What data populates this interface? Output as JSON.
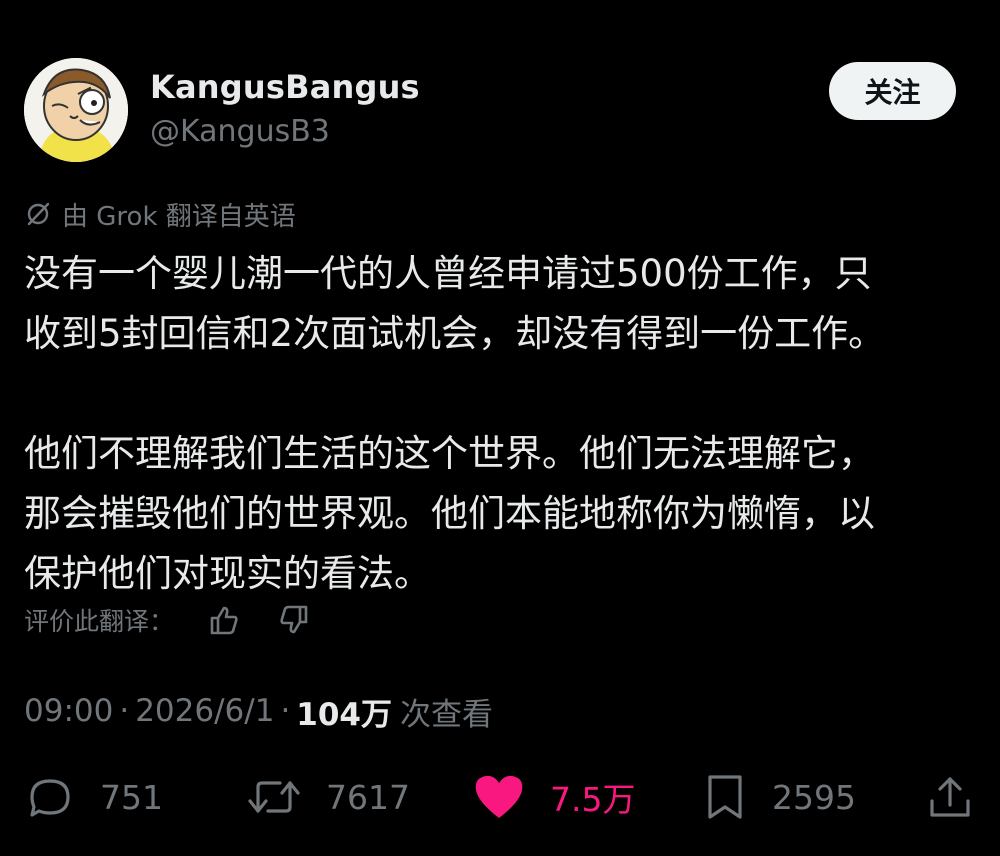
{
  "user": {
    "display_name": "KangusBangus",
    "handle": "@KangusB3",
    "avatar_icon": "cartoon-avatar"
  },
  "follow_label": "关注",
  "translation_note": "由 Grok 翻译自英语",
  "tweet_text": "没有一个婴儿潮一代的人曾经申请过500份工作，只\n收到5封回信和2次面试机会，却没有得到一份工作。\n\n他们不理解我们生活的这个世界。他们无法理解它，\n那会摧毁他们的世界观。他们本能地称你为懒惰，以\n保护他们对现实的看法。",
  "rate_translation_label": "评价此翻译：",
  "meta": {
    "time": "09:00",
    "separator": "·",
    "date": "2026/6/1",
    "views_count": "104万",
    "views_label": "次查看"
  },
  "actions": {
    "reply_count": "751",
    "retweet_count": "7617",
    "like_count": "7.5万",
    "bookmark_count": "2595"
  },
  "colors": {
    "background": "#000000",
    "text": "#e7e9ea",
    "secondary": "#71767b",
    "like": "#f91880",
    "button_bg": "#eff3f4"
  }
}
